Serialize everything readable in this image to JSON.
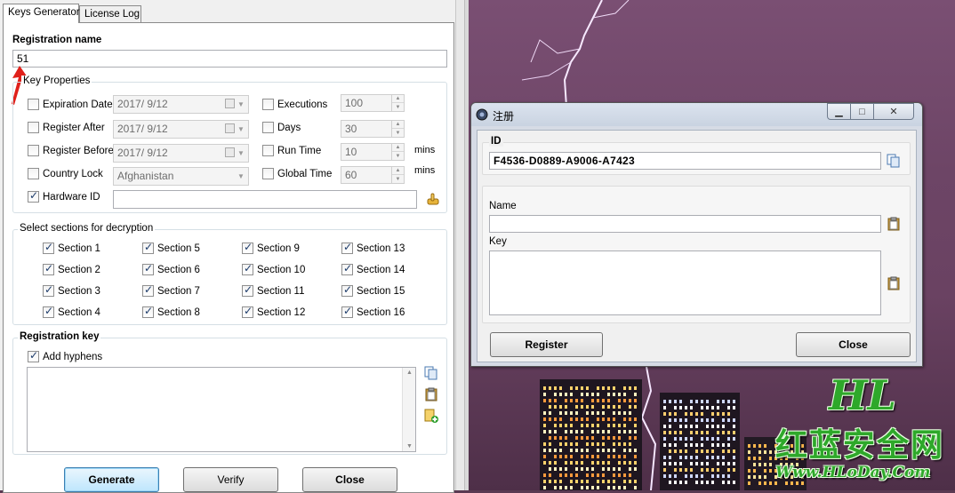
{
  "keygen": {
    "tabs": [
      "Keys Generator",
      "License Log"
    ],
    "registration_name_label": "Registration name",
    "registration_name_value": "51",
    "key_properties_title": "Key Properties",
    "expiration_date": {
      "label": "Expiration Date",
      "checked": false,
      "value": "2017/  9/12"
    },
    "register_after": {
      "label": "Register After",
      "checked": false,
      "value": "2017/  9/12"
    },
    "register_before": {
      "label": "Register Before",
      "checked": false,
      "value": "2017/  9/12"
    },
    "country_lock": {
      "label": "Country Lock",
      "checked": false,
      "value": "Afghanistan"
    },
    "hardware_id": {
      "label": "Hardware ID",
      "checked": true,
      "value": ""
    },
    "executions": {
      "label": "Executions",
      "checked": false,
      "value": "100"
    },
    "days": {
      "label": "Days",
      "checked": false,
      "value": "30"
    },
    "run_time": {
      "label": "Run Time",
      "checked": false,
      "value": "10",
      "unit": "mins"
    },
    "global_time": {
      "label": "Global Time",
      "checked": false,
      "value": "60",
      "unit": "mins"
    },
    "sections_title": "Select sections for decryption",
    "sections": [
      "Section 1",
      "Section 2",
      "Section 3",
      "Section 4",
      "Section 5",
      "Section 6",
      "Section 7",
      "Section 8",
      "Section 9",
      "Section 10",
      "Section 11",
      "Section 12",
      "Section 13",
      "Section 14",
      "Section 15",
      "Section 16"
    ],
    "registration_key_title": "Registration key",
    "add_hyphens": {
      "label": "Add hyphens",
      "checked": true
    },
    "registration_key_value": "",
    "buttons": {
      "generate": "Generate",
      "verify": "Verify",
      "close": "Close"
    }
  },
  "dialog": {
    "title": "注册",
    "id_label": "ID",
    "id_value": "F4536-D0889-A9006-A7423",
    "name_label": "Name",
    "name_value": "",
    "key_label": "Key",
    "key_value": "",
    "buttons": {
      "register": "Register",
      "close": "Close"
    }
  },
  "watermark": {
    "logo": "HL",
    "site_name": "红蓝安全网",
    "url": "Www.HLoDay.Com"
  },
  "colors": {
    "accent": "#3c7fb1",
    "checkmark": "#1c3b6a",
    "watermark_green": "#2ea82a",
    "arrow_red": "#e0201a"
  }
}
